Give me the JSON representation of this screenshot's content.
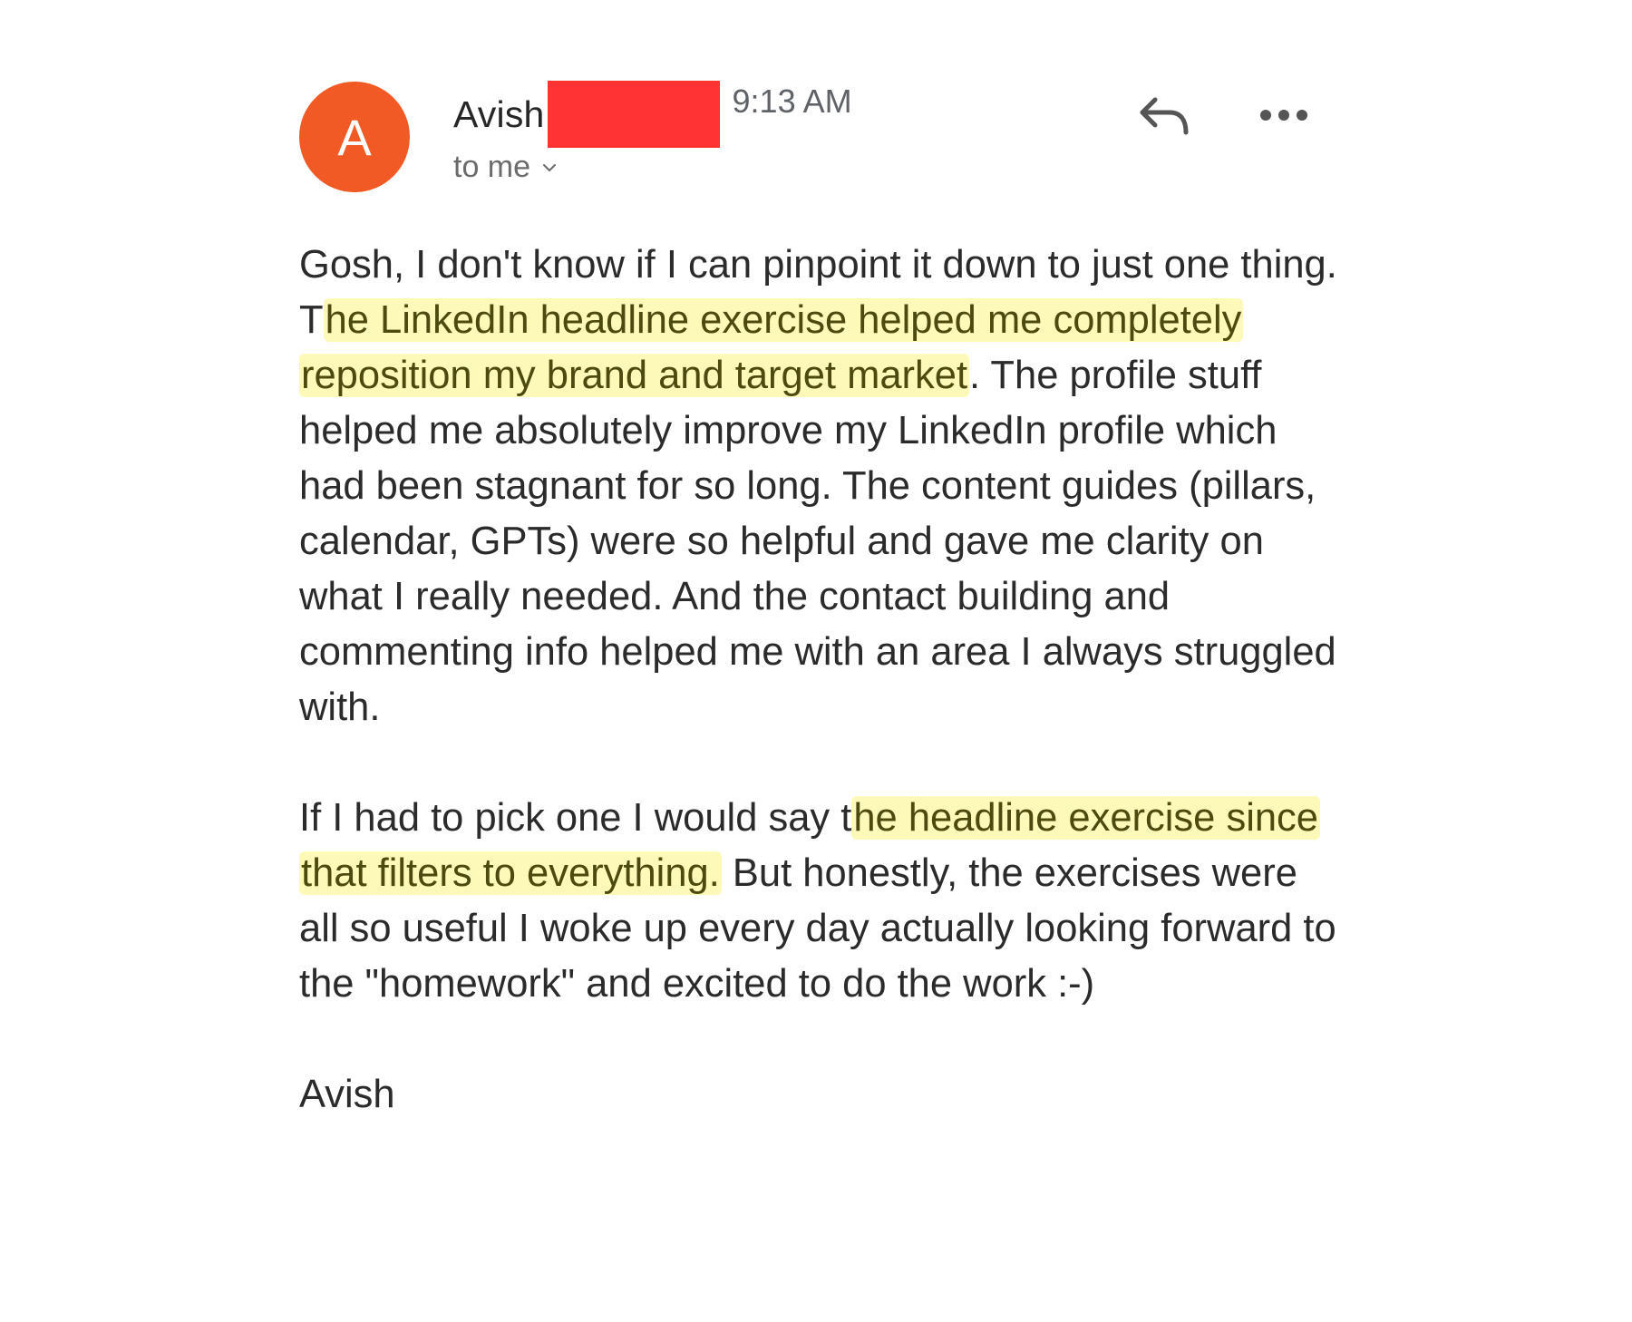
{
  "sender": {
    "avatar_letter": "A",
    "name": "Avish",
    "time": "9:13 AM",
    "recipient": "to me"
  },
  "actions": {
    "reply_icon": "reply-icon",
    "more_icon": "more-options-icon"
  },
  "colors": {
    "avatar": "#f15a24",
    "redaction": "#ff3333",
    "highlight": "#fdf9b8"
  },
  "body": {
    "p1_a": "Gosh, I don't know if I can pinpoint it down to just one thing. T",
    "p1_h": "he LinkedIn headline exercise helped me completely reposition my brand and target market",
    "p1_b": ". The profile stuff helped me absolutely improve my LinkedIn profile which had been stagnant for so long. The content guides (pillars, calendar, GPTs) were so helpful and gave me clarity on what I really needed. And the contact building and commenting info helped me with an area I always struggled with.",
    "p2_a": "If I had to pick one I would say t",
    "p2_h": "he headline exercise since that filters to everything.",
    "p2_b": " But honestly, the exercises were all so useful I woke up every day actually looking forward to the \"homework\" and excited to do the work :-)",
    "signature": "Avish"
  }
}
